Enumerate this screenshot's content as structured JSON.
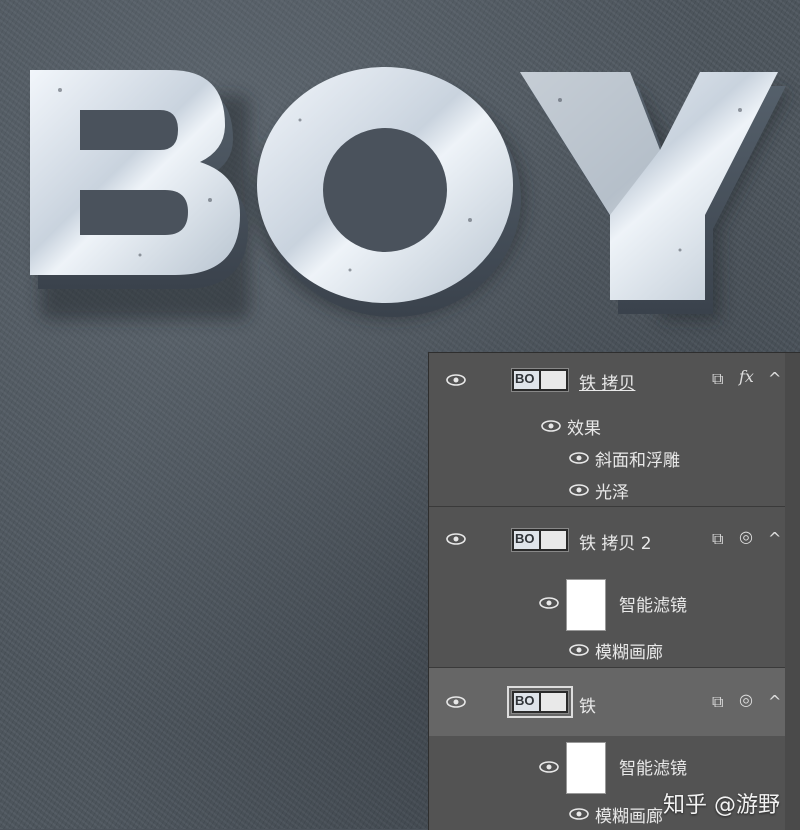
{
  "artwork": {
    "text": "BOY"
  },
  "layers_panel": {
    "layers": [
      {
        "name": "铁 拷贝",
        "fx_label": "fx",
        "effects_header": "效果",
        "effects": [
          "斜面和浮雕",
          "光泽"
        ]
      },
      {
        "name": "铁 拷贝 2",
        "smart_filters_label": "智能滤镜",
        "filters": [
          "模糊画廊"
        ]
      },
      {
        "name": "铁",
        "selected": true,
        "smart_filters_label": "智能滤镜",
        "filters": [
          "模糊画廊"
        ]
      }
    ],
    "collapse_glyph": "^"
  },
  "watermark": "知乎 @游野",
  "colors": {
    "panel_bg": "#535353",
    "panel_selected": "#666666",
    "metal_light": "#dfe6ee",
    "metal_dark": "#3f4650"
  }
}
